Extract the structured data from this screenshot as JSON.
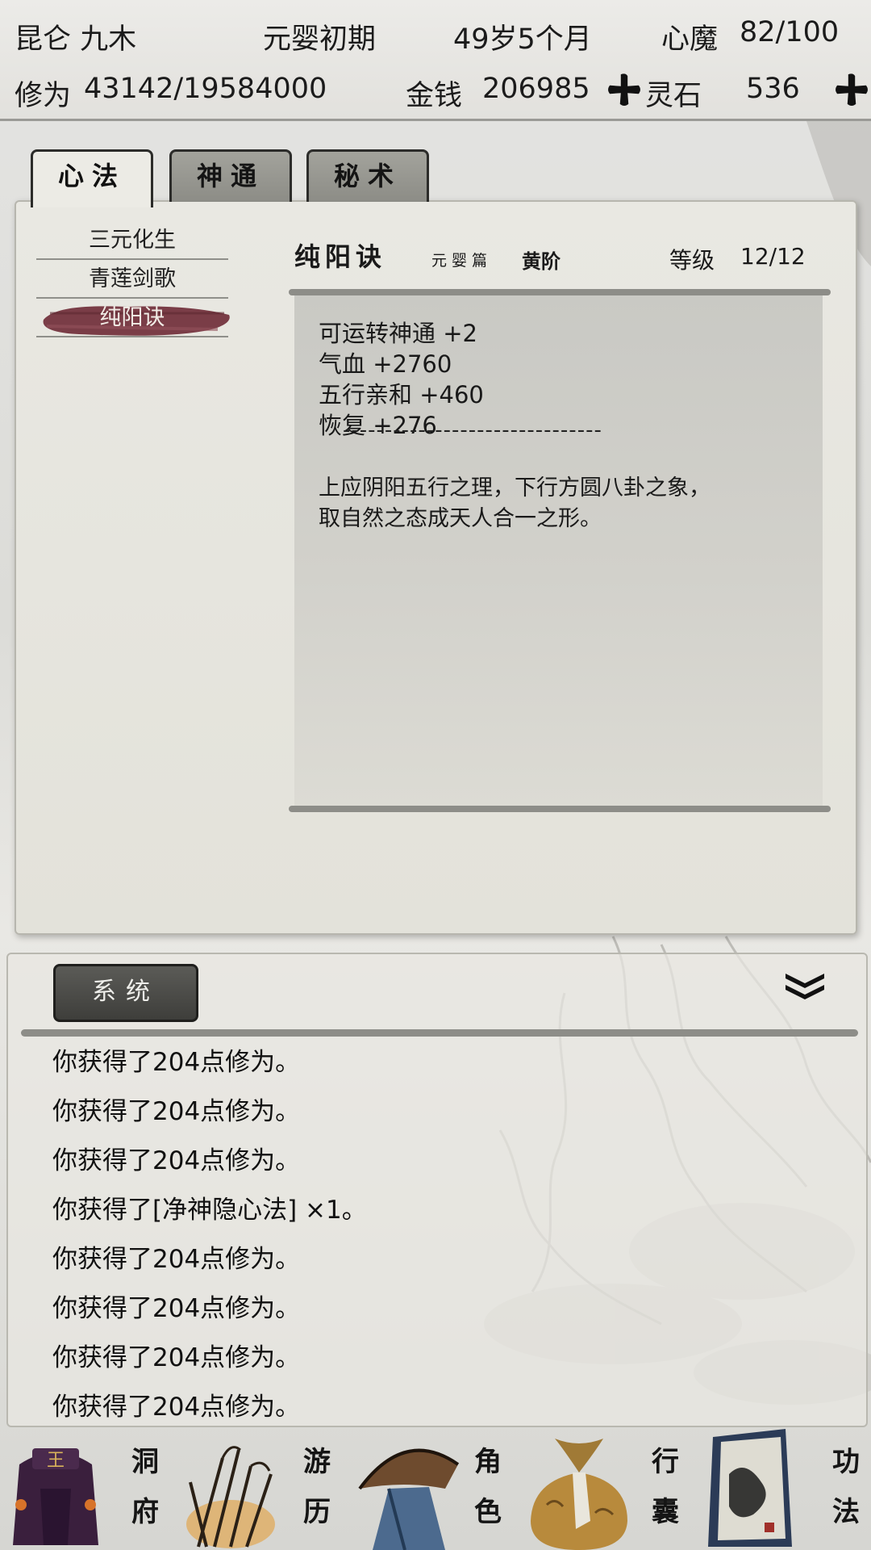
{
  "header": {
    "character_name": "昆仑 九木",
    "realm": "元婴初期",
    "age": "49岁5个月",
    "heart_demon_label": "心魔",
    "heart_demon_value": "82/100",
    "cultivation_label": "修为",
    "cultivation_value": "43142/19584000",
    "money_label": "金钱",
    "money_value": "206985",
    "spirit_stone_label": "灵石",
    "spirit_stone_value": "536"
  },
  "tabs": [
    {
      "label": "心法",
      "active": true
    },
    {
      "label": "神通",
      "active": false
    },
    {
      "label": "秘术",
      "active": false
    }
  ],
  "skill_list": [
    {
      "label": "三元化生"
    },
    {
      "label": "青莲剑歌"
    },
    {
      "label": "纯阳诀",
      "selected": true
    }
  ],
  "skill_detail": {
    "name": "纯阳诀",
    "chapter": "元婴篇",
    "grade": "黄阶",
    "level_label": "等级",
    "level_value": "12/12",
    "stats": [
      "可运转神通 +2",
      "气血 +2760",
      "五行亲和 +460",
      "恢复 +276"
    ],
    "divider": "-------------------------------",
    "description": [
      "上应阴阳五行之理，下行方圆八卦之象，",
      "取自然之态成天人合一之形。"
    ]
  },
  "log": {
    "tab_label": "系统",
    "lines": [
      "你获得了204点修为。",
      "你获得了204点修为。",
      "你获得了204点修为。",
      "你获得了[净神隐心法] ×1。",
      "你获得了204点修为。",
      "你获得了204点修为。",
      "你获得了204点修为。",
      "你获得了204点修为。"
    ]
  },
  "nav": [
    {
      "label_top": "洞",
      "label_bottom": "府",
      "icon": "cave-mansion-icon"
    },
    {
      "label_top": "游",
      "label_bottom": "历",
      "icon": "travel-icon"
    },
    {
      "label_top": "角",
      "label_bottom": "色",
      "icon": "character-icon"
    },
    {
      "label_top": "行",
      "label_bottom": "囊",
      "icon": "bag-icon"
    },
    {
      "label_top": "功",
      "label_bottom": "法",
      "icon": "skills-book-icon"
    }
  ],
  "colors": {
    "selected_brush": "#7a3d47",
    "panel_bg": "#e6e5de",
    "rule_gray": "#8d8d88"
  }
}
